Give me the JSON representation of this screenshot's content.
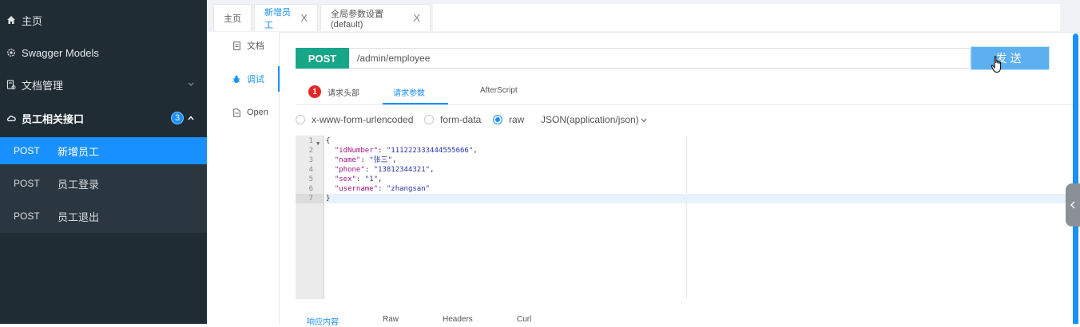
{
  "sidebar": {
    "items": [
      {
        "label": "主页",
        "icon": "home-icon"
      },
      {
        "label": "Swagger Models",
        "icon": "settings-icon"
      },
      {
        "label": "文档管理",
        "icon": "doc-manage-icon"
      },
      {
        "label": "员工相关接口",
        "icon": "cloud-icon",
        "badge": "3"
      }
    ],
    "sub_items": [
      {
        "method": "POST",
        "name": "新增员工"
      },
      {
        "method": "POST",
        "name": "员工登录"
      },
      {
        "method": "POST",
        "name": "员工退出"
      }
    ]
  },
  "tabs": [
    {
      "label": "主页"
    },
    {
      "label": "新增员工",
      "close": "X"
    },
    {
      "label": "全局参数设置(default)",
      "close": "X"
    }
  ],
  "vnav": [
    {
      "label": "文档",
      "icon": "document-icon"
    },
    {
      "label": "调试",
      "icon": "bug-icon"
    },
    {
      "label": "Open",
      "icon": "file-icon"
    }
  ],
  "request": {
    "method": "POST",
    "url": "/admin/employee",
    "send_label": "发送"
  },
  "subtabs": {
    "header_badge": "1",
    "headers": "请求头部",
    "params": "请求参数",
    "afterscript": "AfterScript"
  },
  "body_types": {
    "urlencoded": "x-www-form-urlencoded",
    "formdata": "form-data",
    "raw": "raw",
    "selected": "raw",
    "content_type": "JSON(application/json)"
  },
  "editor": {
    "line_numbers": [
      "1",
      "2",
      "3",
      "4",
      "5",
      "6",
      "7"
    ],
    "lines": [
      {
        "text": "{"
      },
      {
        "key": "\"idNumber\"",
        "value": "\"111222333444555666\"",
        "trail": ","
      },
      {
        "key": "\"name\"",
        "value": "\"张三\"",
        "trail": ","
      },
      {
        "key": "\"phone\"",
        "value": "\"13812344321\"",
        "trail": ","
      },
      {
        "key": "\"sex\"",
        "value": "\"1\"",
        "trail": ","
      },
      {
        "key": "\"username\"",
        "value": "\"zhangsan\"",
        "trail": ""
      },
      {
        "text": "}"
      }
    ]
  },
  "response_tabs": [
    "响应内容",
    "Raw",
    "Headers",
    "Curl"
  ],
  "colors": {
    "sidebar_bg": "#202c34",
    "accent": "#1890ff",
    "post_green": "#18a689",
    "send_blue": "#5db0ef",
    "error_red": "#e82525"
  }
}
